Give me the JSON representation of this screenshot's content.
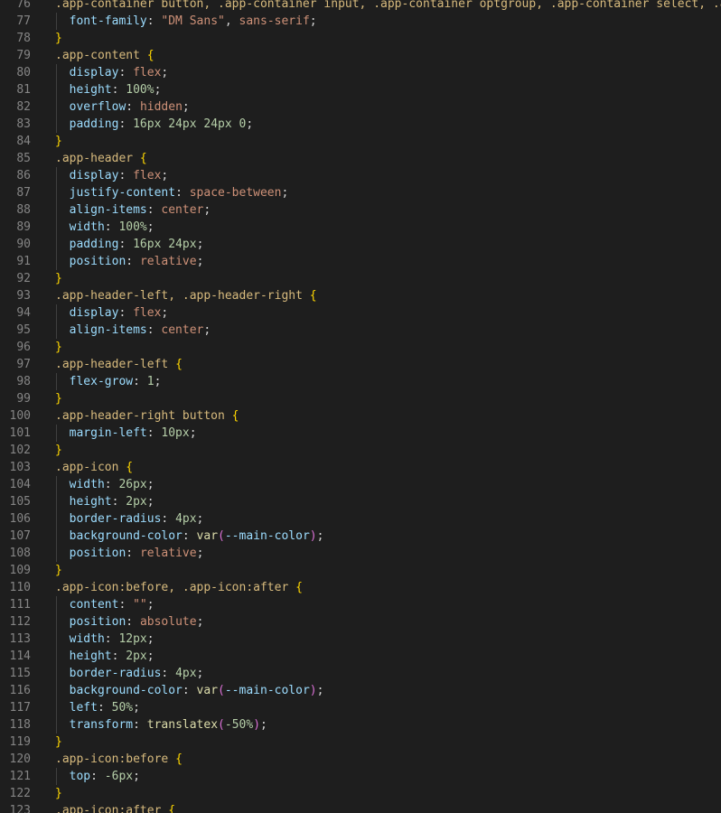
{
  "editor": {
    "colors": {
      "background": "#1e1e1e",
      "line_number": "#858585",
      "selector": "#d7ba7d",
      "property": "#9cdcfe",
      "value": "#ce9178",
      "number": "#b5cea8",
      "function": "#dcdcaa",
      "brace": "#ffd700",
      "paren": "#da70d6"
    },
    "lines": [
      {
        "n": "76",
        "indent": false,
        "tokens": [
          [
            "sel",
            ".app-container button, .app-container input, .app-container optgroup, .app-container select, .app-container textarea "
          ],
          [
            "b1",
            "{"
          ]
        ]
      },
      {
        "n": "77",
        "indent": true,
        "tokens": [
          [
            "prop",
            "font-family"
          ],
          [
            "punc",
            ": "
          ],
          [
            "str",
            "\"DM Sans\""
          ],
          [
            "punc",
            ", "
          ],
          [
            "val",
            "sans-serif"
          ],
          [
            "punc",
            ";"
          ]
        ]
      },
      {
        "n": "78",
        "indent": false,
        "tokens": [
          [
            "b1",
            "}"
          ]
        ]
      },
      {
        "n": "79",
        "indent": false,
        "tokens": [
          [
            "sel",
            ".app-content "
          ],
          [
            "b1",
            "{"
          ]
        ]
      },
      {
        "n": "80",
        "indent": true,
        "tokens": [
          [
            "prop",
            "display"
          ],
          [
            "punc",
            ": "
          ],
          [
            "val",
            "flex"
          ],
          [
            "punc",
            ";"
          ]
        ]
      },
      {
        "n": "81",
        "indent": true,
        "tokens": [
          [
            "prop",
            "height"
          ],
          [
            "punc",
            ": "
          ],
          [
            "num",
            "100%"
          ],
          [
            "punc",
            ";"
          ]
        ]
      },
      {
        "n": "82",
        "indent": true,
        "tokens": [
          [
            "prop",
            "overflow"
          ],
          [
            "punc",
            ": "
          ],
          [
            "val",
            "hidden"
          ],
          [
            "punc",
            ";"
          ]
        ]
      },
      {
        "n": "83",
        "indent": true,
        "tokens": [
          [
            "prop",
            "padding"
          ],
          [
            "punc",
            ": "
          ],
          [
            "num",
            "16px 24px 24px 0"
          ],
          [
            "punc",
            ";"
          ]
        ]
      },
      {
        "n": "84",
        "indent": false,
        "tokens": [
          [
            "b1",
            "}"
          ]
        ]
      },
      {
        "n": "85",
        "indent": false,
        "tokens": [
          [
            "sel",
            ".app-header "
          ],
          [
            "b1",
            "{"
          ]
        ]
      },
      {
        "n": "86",
        "indent": true,
        "tokens": [
          [
            "prop",
            "display"
          ],
          [
            "punc",
            ": "
          ],
          [
            "val",
            "flex"
          ],
          [
            "punc",
            ";"
          ]
        ]
      },
      {
        "n": "87",
        "indent": true,
        "tokens": [
          [
            "prop",
            "justify-content"
          ],
          [
            "punc",
            ": "
          ],
          [
            "val",
            "space-between"
          ],
          [
            "punc",
            ";"
          ]
        ]
      },
      {
        "n": "88",
        "indent": true,
        "tokens": [
          [
            "prop",
            "align-items"
          ],
          [
            "punc",
            ": "
          ],
          [
            "val",
            "center"
          ],
          [
            "punc",
            ";"
          ]
        ]
      },
      {
        "n": "89",
        "indent": true,
        "tokens": [
          [
            "prop",
            "width"
          ],
          [
            "punc",
            ": "
          ],
          [
            "num",
            "100%"
          ],
          [
            "punc",
            ";"
          ]
        ]
      },
      {
        "n": "90",
        "indent": true,
        "tokens": [
          [
            "prop",
            "padding"
          ],
          [
            "punc",
            ": "
          ],
          [
            "num",
            "16px 24px"
          ],
          [
            "punc",
            ";"
          ]
        ]
      },
      {
        "n": "91",
        "indent": true,
        "tokens": [
          [
            "prop",
            "position"
          ],
          [
            "punc",
            ": "
          ],
          [
            "val",
            "relative"
          ],
          [
            "punc",
            ";"
          ]
        ]
      },
      {
        "n": "92",
        "indent": false,
        "tokens": [
          [
            "b1",
            "}"
          ]
        ]
      },
      {
        "n": "93",
        "indent": false,
        "tokens": [
          [
            "sel",
            ".app-header-left, .app-header-right "
          ],
          [
            "b1",
            "{"
          ]
        ]
      },
      {
        "n": "94",
        "indent": true,
        "tokens": [
          [
            "prop",
            "display"
          ],
          [
            "punc",
            ": "
          ],
          [
            "val",
            "flex"
          ],
          [
            "punc",
            ";"
          ]
        ]
      },
      {
        "n": "95",
        "indent": true,
        "tokens": [
          [
            "prop",
            "align-items"
          ],
          [
            "punc",
            ": "
          ],
          [
            "val",
            "center"
          ],
          [
            "punc",
            ";"
          ]
        ]
      },
      {
        "n": "96",
        "indent": false,
        "tokens": [
          [
            "b1",
            "}"
          ]
        ]
      },
      {
        "n": "97",
        "indent": false,
        "tokens": [
          [
            "sel",
            ".app-header-left "
          ],
          [
            "b1",
            "{"
          ]
        ]
      },
      {
        "n": "98",
        "indent": true,
        "tokens": [
          [
            "prop",
            "flex-grow"
          ],
          [
            "punc",
            ": "
          ],
          [
            "num",
            "1"
          ],
          [
            "punc",
            ";"
          ]
        ]
      },
      {
        "n": "99",
        "indent": false,
        "tokens": [
          [
            "b1",
            "}"
          ]
        ]
      },
      {
        "n": "100",
        "indent": false,
        "tokens": [
          [
            "sel",
            ".app-header-right button "
          ],
          [
            "b1",
            "{"
          ]
        ]
      },
      {
        "n": "101",
        "indent": true,
        "tokens": [
          [
            "prop",
            "margin-left"
          ],
          [
            "punc",
            ": "
          ],
          [
            "num",
            "10px"
          ],
          [
            "punc",
            ";"
          ]
        ]
      },
      {
        "n": "102",
        "indent": false,
        "tokens": [
          [
            "b1",
            "}"
          ]
        ]
      },
      {
        "n": "103",
        "indent": false,
        "tokens": [
          [
            "sel",
            ".app-icon "
          ],
          [
            "b1",
            "{"
          ]
        ]
      },
      {
        "n": "104",
        "indent": true,
        "tokens": [
          [
            "prop",
            "width"
          ],
          [
            "punc",
            ": "
          ],
          [
            "num",
            "26px"
          ],
          [
            "punc",
            ";"
          ]
        ]
      },
      {
        "n": "105",
        "indent": true,
        "tokens": [
          [
            "prop",
            "height"
          ],
          [
            "punc",
            ": "
          ],
          [
            "num",
            "2px"
          ],
          [
            "punc",
            ";"
          ]
        ]
      },
      {
        "n": "106",
        "indent": true,
        "tokens": [
          [
            "prop",
            "border-radius"
          ],
          [
            "punc",
            ": "
          ],
          [
            "num",
            "4px"
          ],
          [
            "punc",
            ";"
          ]
        ]
      },
      {
        "n": "107",
        "indent": true,
        "tokens": [
          [
            "prop",
            "background-color"
          ],
          [
            "punc",
            ": "
          ],
          [
            "fn",
            "var"
          ],
          [
            "b2",
            "("
          ],
          [
            "prop",
            "--main-color"
          ],
          [
            "b2",
            ")"
          ],
          [
            "punc",
            ";"
          ]
        ]
      },
      {
        "n": "108",
        "indent": true,
        "tokens": [
          [
            "prop",
            "position"
          ],
          [
            "punc",
            ": "
          ],
          [
            "val",
            "relative"
          ],
          [
            "punc",
            ";"
          ]
        ]
      },
      {
        "n": "109",
        "indent": false,
        "tokens": [
          [
            "b1",
            "}"
          ]
        ]
      },
      {
        "n": "110",
        "indent": false,
        "tokens": [
          [
            "sel",
            ".app-icon:before, .app-icon:after "
          ],
          [
            "b1",
            "{"
          ]
        ]
      },
      {
        "n": "111",
        "indent": true,
        "tokens": [
          [
            "prop",
            "content"
          ],
          [
            "punc",
            ": "
          ],
          [
            "str",
            "\"\""
          ],
          [
            "punc",
            ";"
          ]
        ]
      },
      {
        "n": "112",
        "indent": true,
        "tokens": [
          [
            "prop",
            "position"
          ],
          [
            "punc",
            ": "
          ],
          [
            "val",
            "absolute"
          ],
          [
            "punc",
            ";"
          ]
        ]
      },
      {
        "n": "113",
        "indent": true,
        "tokens": [
          [
            "prop",
            "width"
          ],
          [
            "punc",
            ": "
          ],
          [
            "num",
            "12px"
          ],
          [
            "punc",
            ";"
          ]
        ]
      },
      {
        "n": "114",
        "indent": true,
        "tokens": [
          [
            "prop",
            "height"
          ],
          [
            "punc",
            ": "
          ],
          [
            "num",
            "2px"
          ],
          [
            "punc",
            ";"
          ]
        ]
      },
      {
        "n": "115",
        "indent": true,
        "tokens": [
          [
            "prop",
            "border-radius"
          ],
          [
            "punc",
            ": "
          ],
          [
            "num",
            "4px"
          ],
          [
            "punc",
            ";"
          ]
        ]
      },
      {
        "n": "116",
        "indent": true,
        "tokens": [
          [
            "prop",
            "background-color"
          ],
          [
            "punc",
            ": "
          ],
          [
            "fn",
            "var"
          ],
          [
            "b2",
            "("
          ],
          [
            "prop",
            "--main-color"
          ],
          [
            "b2",
            ")"
          ],
          [
            "punc",
            ";"
          ]
        ]
      },
      {
        "n": "117",
        "indent": true,
        "tokens": [
          [
            "prop",
            "left"
          ],
          [
            "punc",
            ": "
          ],
          [
            "num",
            "50%"
          ],
          [
            "punc",
            ";"
          ]
        ]
      },
      {
        "n": "118",
        "indent": true,
        "tokens": [
          [
            "prop",
            "transform"
          ],
          [
            "punc",
            ": "
          ],
          [
            "fn",
            "translatex"
          ],
          [
            "b2",
            "("
          ],
          [
            "num",
            "-50%"
          ],
          [
            "b2",
            ")"
          ],
          [
            "punc",
            ";"
          ]
        ]
      },
      {
        "n": "119",
        "indent": false,
        "tokens": [
          [
            "b1",
            "}"
          ]
        ]
      },
      {
        "n": "120",
        "indent": false,
        "tokens": [
          [
            "sel",
            ".app-icon:before "
          ],
          [
            "b1",
            "{"
          ]
        ]
      },
      {
        "n": "121",
        "indent": true,
        "tokens": [
          [
            "prop",
            "top"
          ],
          [
            "punc",
            ": "
          ],
          [
            "num",
            "-6px"
          ],
          [
            "punc",
            ";"
          ]
        ]
      },
      {
        "n": "122",
        "indent": false,
        "tokens": [
          [
            "b1",
            "}"
          ]
        ]
      },
      {
        "n": "123",
        "indent": false,
        "tokens": [
          [
            "sel",
            ".app-icon:after "
          ],
          [
            "b1",
            "{"
          ]
        ]
      }
    ]
  }
}
